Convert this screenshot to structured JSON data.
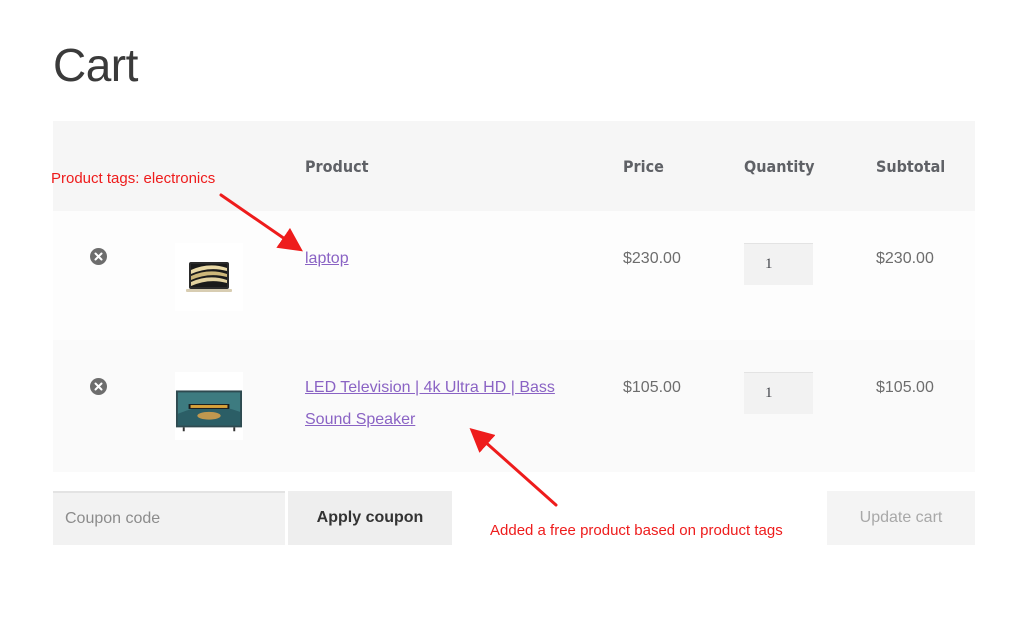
{
  "page": {
    "title": "Cart"
  },
  "table": {
    "headers": {
      "product": "Product",
      "price": "Price",
      "quantity": "Quantity",
      "subtotal": "Subtotal"
    },
    "rows": [
      {
        "product_name": "laptop",
        "price": "$230.00",
        "quantity": "1",
        "subtotal": "$230.00",
        "thumbnail": "laptop-image"
      },
      {
        "product_name": "LED Television | 4k Ultra HD | Bass Sound Speaker",
        "price": "$105.00",
        "quantity": "1",
        "subtotal": "$105.00",
        "thumbnail": "television-image"
      }
    ]
  },
  "actions": {
    "coupon_placeholder": "Coupon code",
    "apply_coupon_label": "Apply coupon",
    "update_cart_label": "Update cart"
  },
  "annotations": {
    "tags_note": "Product tags: electronics",
    "free_note": "Added a free product based on product tags",
    "color": "#ee1c1c"
  },
  "colors": {
    "link": "#8a63c4",
    "header_bg": "#f6f6f6",
    "input_bg": "#f2f2f2"
  }
}
